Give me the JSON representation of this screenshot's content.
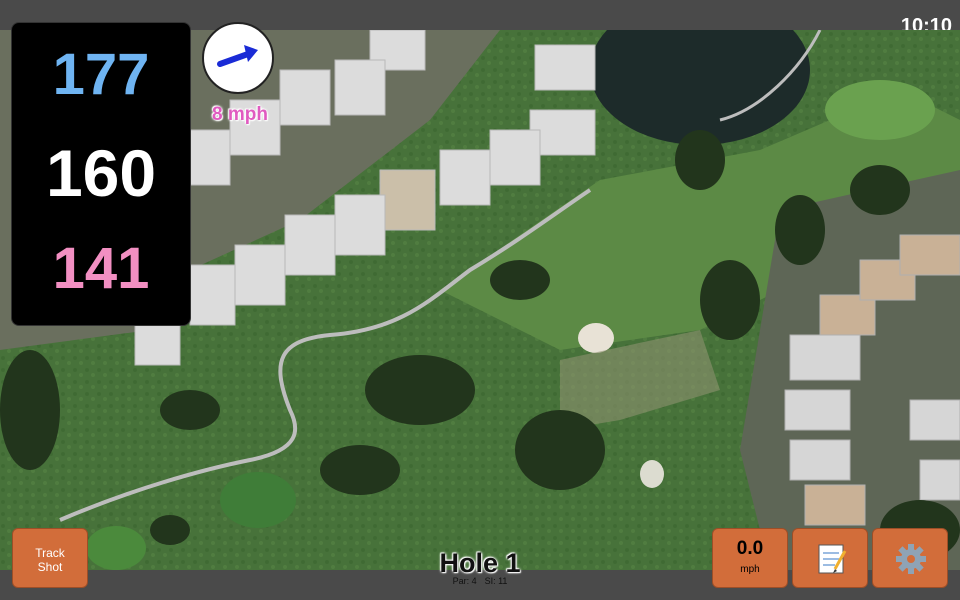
{
  "status_bar": {
    "time": "10:10"
  },
  "yardages": {
    "back": "177",
    "middle": "160",
    "front": "141"
  },
  "wind": {
    "speed": "8 mph",
    "direction_icon": "arrow-right-icon"
  },
  "hole": {
    "title": "Hole 1",
    "par": "Par: 4",
    "stroke_index": "SI: 11"
  },
  "buttons": {
    "track_shot_line1": "Track",
    "track_shot_line2": "Shot",
    "speed_value": "0.0",
    "speed_unit": "mph",
    "notes_icon": "notepad-icon",
    "settings_icon": "gear-icon"
  },
  "colors": {
    "back_yardage": "#6fb4f2",
    "middle_yardage": "#ffffff",
    "front_yardage": "#f28fc2",
    "button": "#d26d3a",
    "wind_speed": "#e05ac0"
  }
}
